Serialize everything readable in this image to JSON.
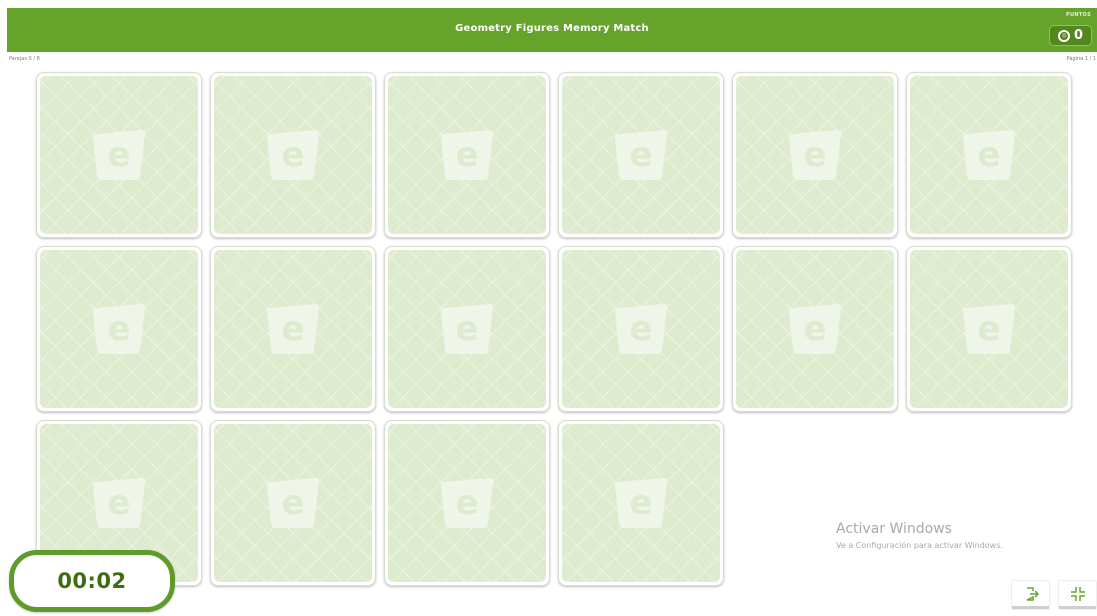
{
  "header": {
    "title": "Geometry Figures Memory Match",
    "points_label": "PUNTOS",
    "points_value": "0"
  },
  "status": {
    "pairs": "Parejas 0 / 8",
    "page": "Página 1 / 1"
  },
  "cards": [
    {
      "state": "face-down"
    },
    {
      "state": "face-down"
    },
    {
      "state": "face-down"
    },
    {
      "state": "face-down"
    },
    {
      "state": "face-down"
    },
    {
      "state": "face-down"
    },
    {
      "state": "face-down"
    },
    {
      "state": "face-down"
    },
    {
      "state": "face-down"
    },
    {
      "state": "face-down"
    },
    {
      "state": "face-down"
    },
    {
      "state": "face-down"
    },
    {
      "state": "face-down"
    },
    {
      "state": "face-down"
    },
    {
      "state": "face-down"
    },
    {
      "state": "face-down"
    }
  ],
  "timer": "00:02",
  "watermark": {
    "title": "Activar Windows",
    "subtitle": "Ve a Configuración para activar Windows."
  },
  "buttons": {
    "exit_icon": "exit-icon",
    "fullscreen_icon": "exit-fullscreen-icon"
  },
  "colors": {
    "accent": "#66a32a",
    "card_back": "#dfebcf",
    "timer_text": "#3d6c12"
  }
}
